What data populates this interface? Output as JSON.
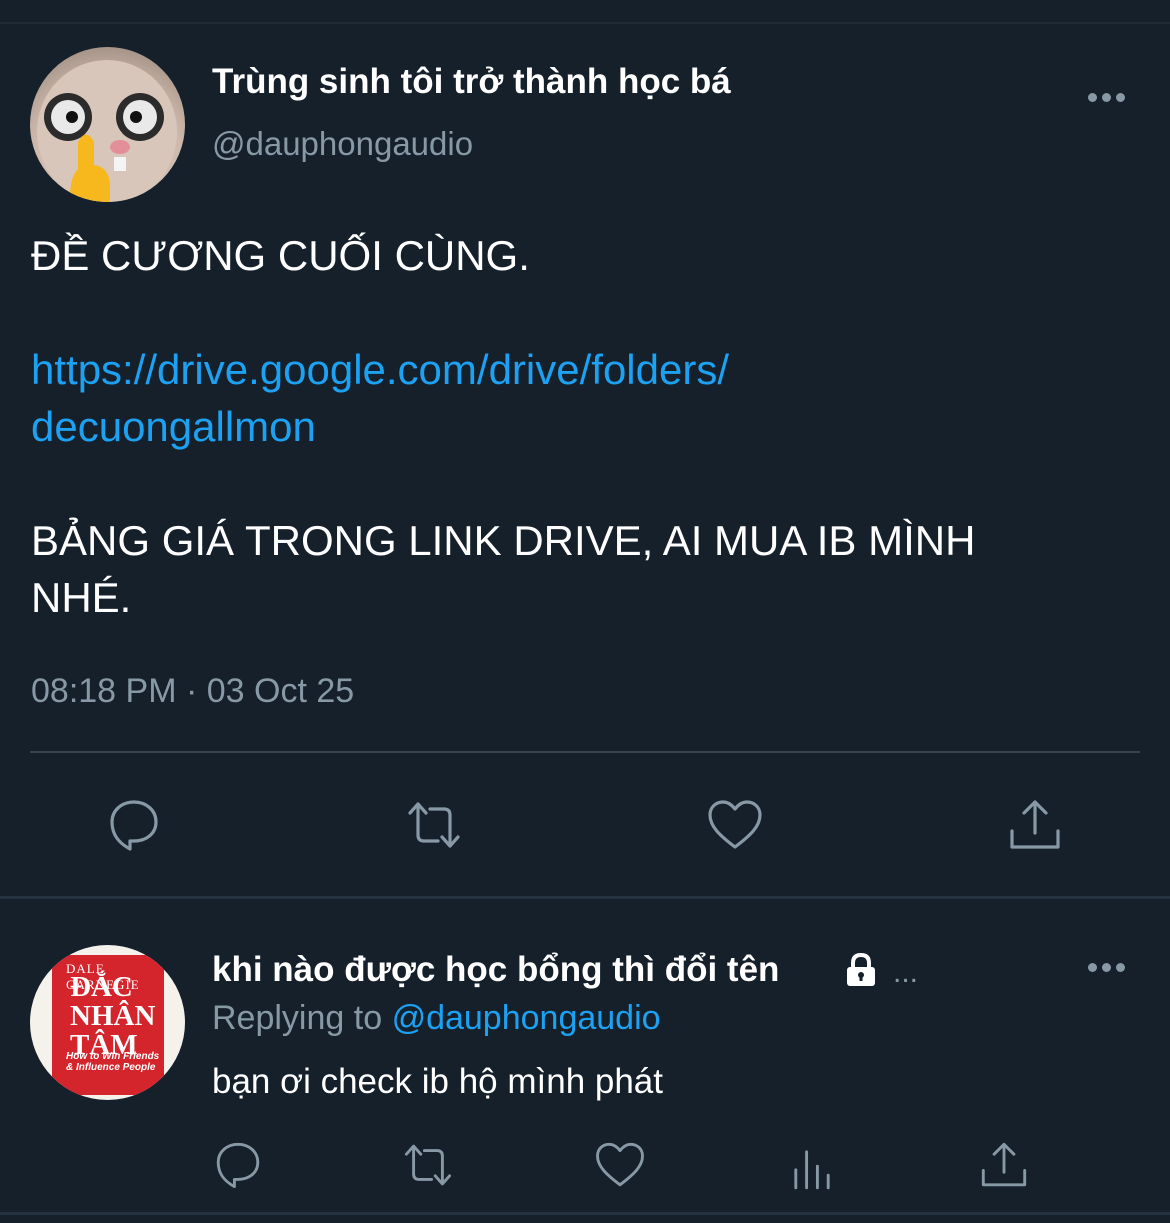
{
  "tweet": {
    "display_name": "Trùng sinh tôi trở thành học bá",
    "handle": "@dauphongaudio",
    "line1": "ĐỀ CƯƠNG CUỐI CÙNG.",
    "link_line1": "https://drive.google.com/drive/folders/",
    "link_line2": "decuongallmon",
    "line3": "BẢNG GIÁ TRONG LINK DRIVE, AI MUA IB MÌNH",
    "line4": "NHÉ.",
    "timestamp": "08:18 PM · 03 Oct 25",
    "actions": [
      "reply-icon",
      "retweet-icon",
      "like-icon",
      "share-icon"
    ]
  },
  "reply": {
    "display_name": "khi nào được học bổng thì đổi tên",
    "ellipsis": "...",
    "replying_to_prefix": "Replying to",
    "replying_to_handle": "@dauphongaudio",
    "text": "bạn ơi check ib hộ mình phát",
    "avatar_book": {
      "author": "DALE CARNEGIE",
      "title": "ĐẮC NHÂN TÂM",
      "subtitle": "How to Win Friends & Influence People"
    },
    "actions": [
      "reply-icon",
      "retweet-icon",
      "analytics-icon",
      "share-icon"
    ]
  },
  "colors": {
    "background": "#15202b",
    "link": "#1da1f2",
    "secondary_text": "#8899a6"
  }
}
